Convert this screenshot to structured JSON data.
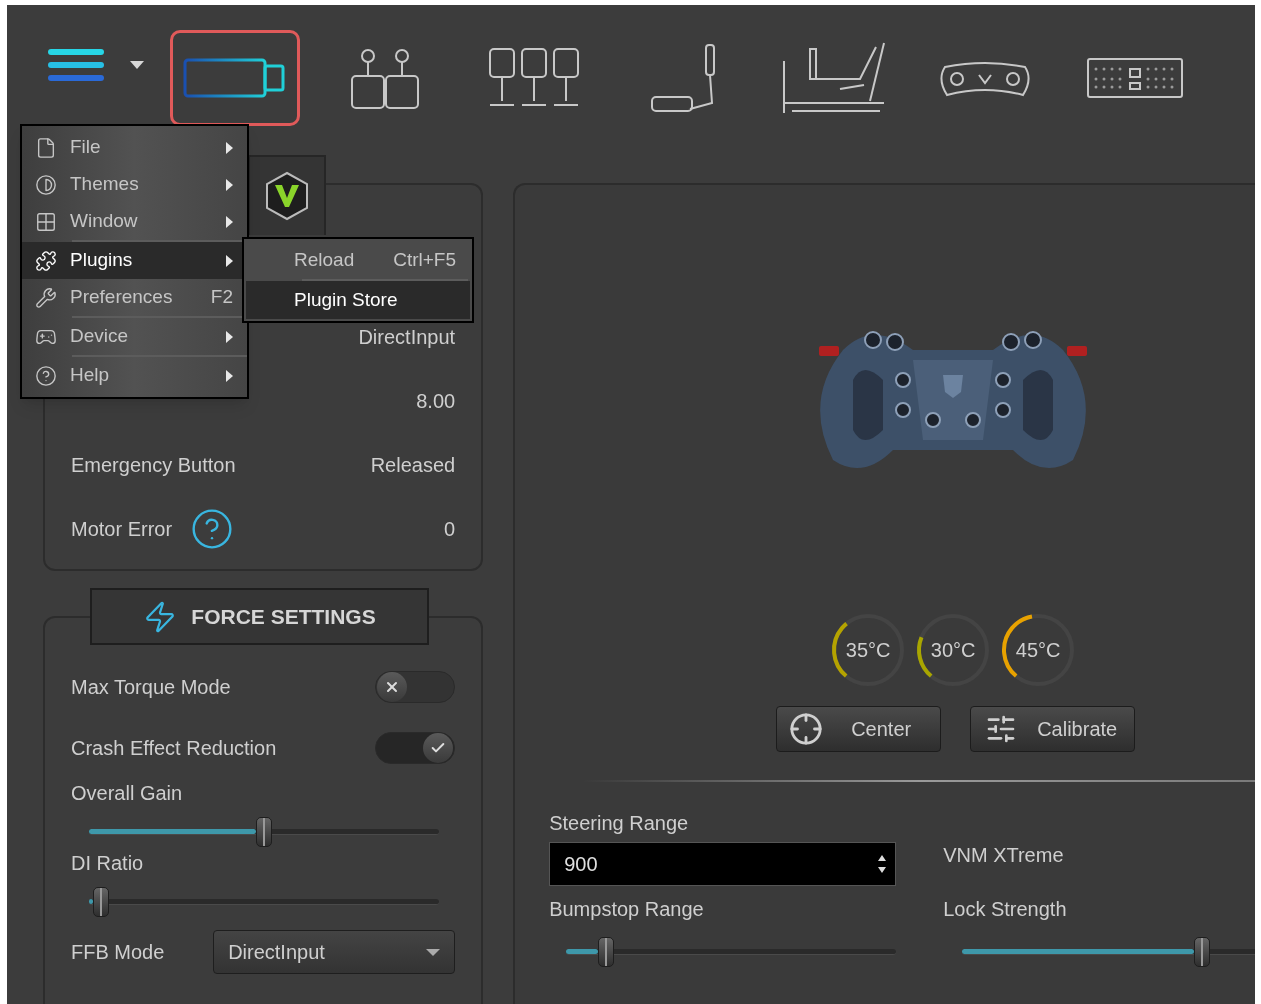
{
  "toolbar": {
    "devices": [
      {
        "kind": "base",
        "selected": true
      },
      {
        "kind": "shifter",
        "selected": false
      },
      {
        "kind": "pedals",
        "selected": false
      },
      {
        "kind": "handbrake",
        "selected": false
      },
      {
        "kind": "rig",
        "selected": false
      },
      {
        "kind": "wheel",
        "selected": false
      },
      {
        "kind": "buttonbox",
        "selected": false
      }
    ]
  },
  "menu": {
    "items": [
      {
        "label": "File",
        "submenu": true,
        "selected": false,
        "divider_below": false
      },
      {
        "label": "Themes",
        "submenu": true,
        "selected": false,
        "divider_below": false
      },
      {
        "label": "Window",
        "submenu": true,
        "selected": false,
        "divider_below": true
      },
      {
        "label": "Plugins",
        "submenu": true,
        "selected": true,
        "divider_below": false
      },
      {
        "label": "Preferences",
        "shortcut": "F2",
        "submenu": false,
        "selected": false,
        "divider_below": true
      },
      {
        "label": "Device",
        "submenu": true,
        "selected": false,
        "divider_below": true
      },
      {
        "label": "Help",
        "submenu": true,
        "selected": false,
        "divider_below": false
      }
    ],
    "submenu": [
      {
        "label": "Reload",
        "shortcut": "Ctrl+F5",
        "selected": false,
        "divider_below": true
      },
      {
        "label": "Plugin Store",
        "selected": true,
        "divider_below": false
      }
    ]
  },
  "info": {
    "rows": [
      {
        "kind": "plain",
        "value": "DirectInput"
      },
      {
        "kind": "plain",
        "value": "8.00"
      },
      {
        "kind": "plain",
        "label": "Emergency Button",
        "value": "Released"
      },
      {
        "kind": "help",
        "label": "Motor Error",
        "value": "0"
      }
    ]
  },
  "force_settings": {
    "title": "FORCE SETTINGS",
    "rows": [
      {
        "kind": "toggle",
        "label": "Max Torque Mode",
        "on": false
      },
      {
        "kind": "toggle",
        "label": "Crash Effect Reduction",
        "on": true
      },
      {
        "kind": "slider",
        "label": "Overall Gain",
        "level": 0.5
      },
      {
        "kind": "slider",
        "label": "DI Ratio",
        "level": 0.035
      },
      {
        "kind": "select",
        "label": "FFB Mode",
        "value": "DirectInput"
      }
    ]
  },
  "device_panel": {
    "temperatures": [
      {
        "reading": "35°C",
        "level": 0.28,
        "color": "#b5a300"
      },
      {
        "reading": "30°C",
        "level": 0.2,
        "color": "#a9a600"
      },
      {
        "reading": "45°C",
        "level": 0.36,
        "color": "#e8a200"
      }
    ],
    "buttons": [
      {
        "kind": "center",
        "label": "Center"
      },
      {
        "kind": "calibrate",
        "label": "Calibrate"
      }
    ],
    "steering_range": {
      "label": "Steering Range",
      "value": "900"
    },
    "bumpstop_range": {
      "label": "Bumpstop Range",
      "level": 0.12
    },
    "model": "VNM XTreme",
    "lock_strength": {
      "label": "Lock Strength",
      "level": 0.8
    }
  }
}
